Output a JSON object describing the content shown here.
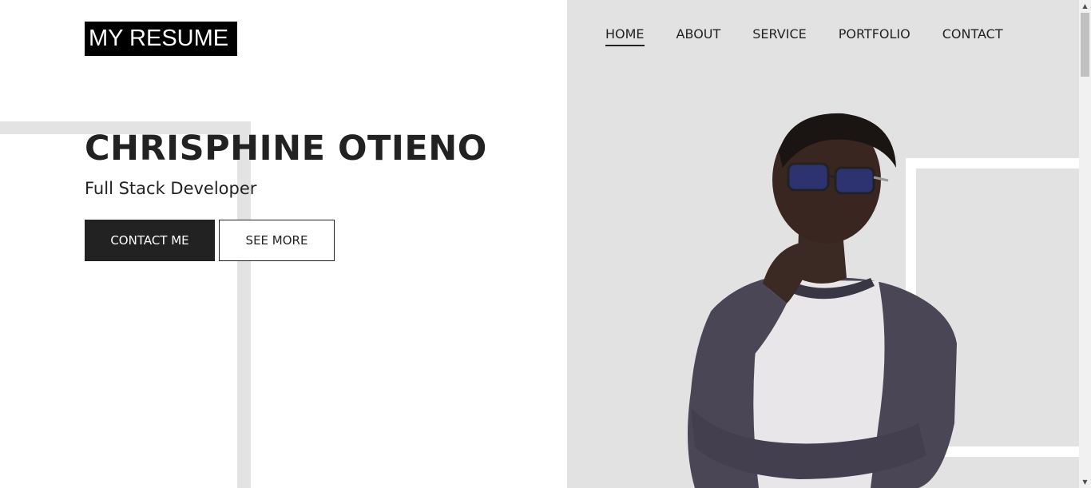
{
  "logo": {
    "text": "MY RESUME"
  },
  "nav": {
    "items": [
      {
        "label": "HOME",
        "active": true
      },
      {
        "label": "ABOUT"
      },
      {
        "label": "SERVICE"
      },
      {
        "label": "PORTFOLIO"
      },
      {
        "label": "CONTACT"
      }
    ]
  },
  "hero": {
    "name": "CHRISPHINE OTIENO",
    "role": "Full Stack Developer",
    "primary_button": "CONTACT ME",
    "secondary_button": "SEE MORE"
  },
  "colors": {
    "text": "#222222",
    "panel": "#e2e2e2",
    "logo_bg": "#000000",
    "button_dark": "#222222"
  },
  "icons": {
    "scroll_up": "triangle-up-icon",
    "scroll_down": "triangle-down-icon"
  }
}
